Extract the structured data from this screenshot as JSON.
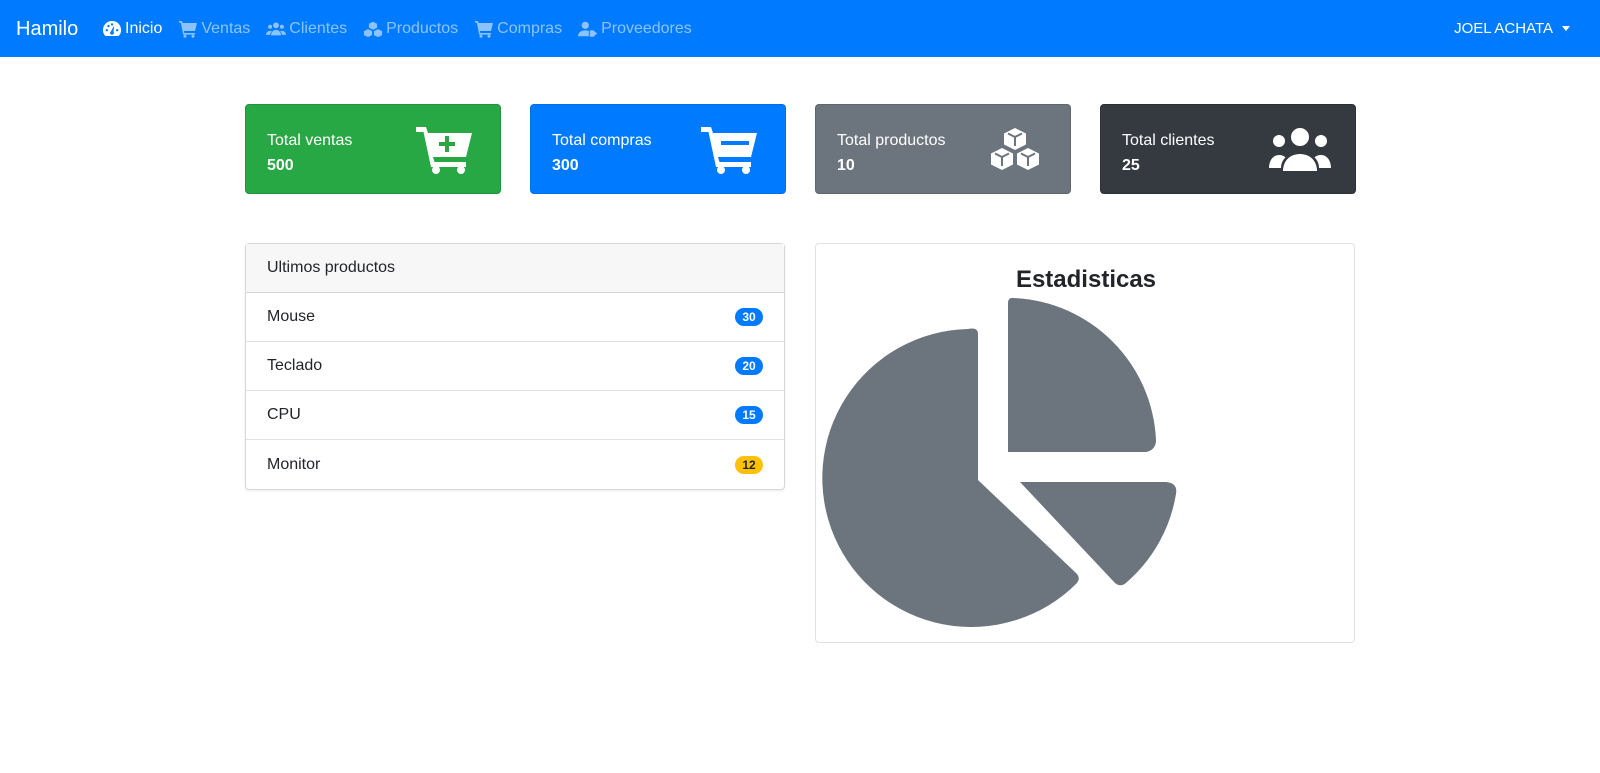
{
  "brand": "Hamilo",
  "nav": [
    {
      "label": "Inicio",
      "icon": "dashboard-icon",
      "active": true
    },
    {
      "label": "Ventas",
      "icon": "cart-icon"
    },
    {
      "label": "Clientes",
      "icon": "users-icon"
    },
    {
      "label": "Productos",
      "icon": "cubes-icon"
    },
    {
      "label": "Compras",
      "icon": "cart-icon"
    },
    {
      "label": "Proveedores",
      "icon": "user-tag-icon"
    }
  ],
  "user": "JOEL ACHATA",
  "stats": [
    {
      "label": "Total ventas",
      "value": "500",
      "icon": "cart-plus-icon",
      "color": "#28a745"
    },
    {
      "label": "Total compras",
      "value": "300",
      "icon": "shopping-cart-icon",
      "color": "#007bff"
    },
    {
      "label": "Total productos",
      "value": "10",
      "icon": "cubes-icon",
      "color": "#6c757d"
    },
    {
      "label": "Total clientes",
      "value": "25",
      "icon": "users-icon",
      "color": "#343a40"
    }
  ],
  "products": {
    "title": "Ultimos productos",
    "items": [
      {
        "name": "Mouse",
        "count": "30"
      },
      {
        "name": "Teclado",
        "count": "20"
      },
      {
        "name": "CPU",
        "count": "15"
      },
      {
        "name": "Monitor",
        "count": "12"
      }
    ]
  },
  "stats_panel": {
    "title": "Estadisticas",
    "icon": "chart-pie-icon",
    "color": "#6c757d"
  }
}
